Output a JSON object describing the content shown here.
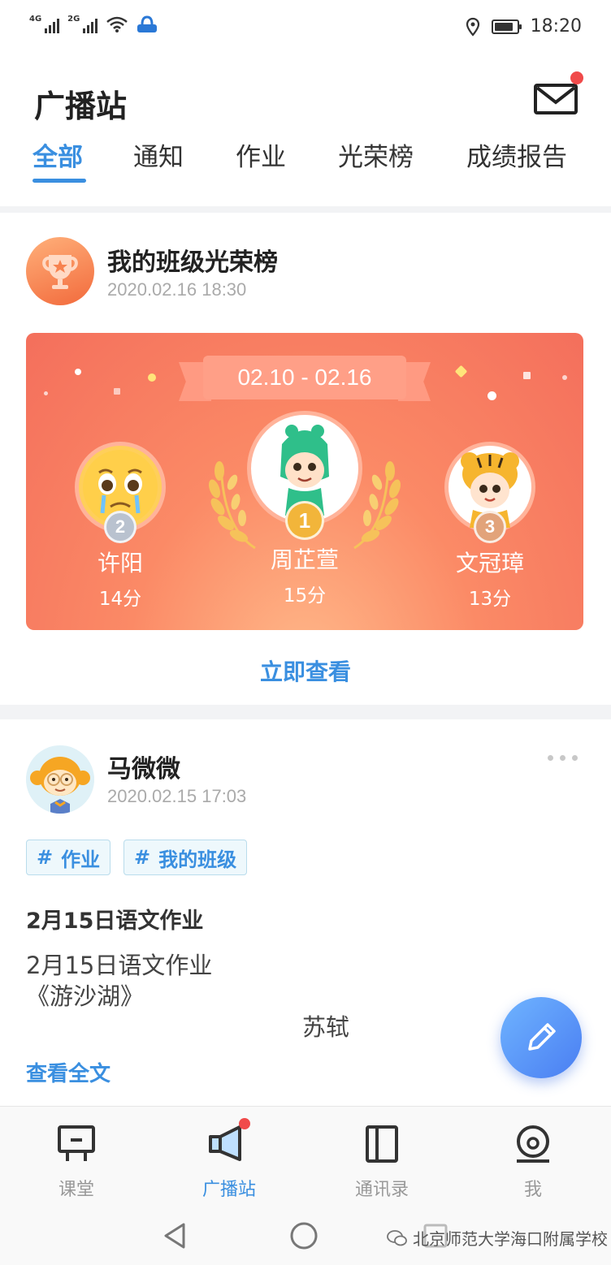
{
  "status_bar": {
    "network1": "4G",
    "network2": "2G",
    "time": "18:20",
    "battery_level": 0.85
  },
  "header": {
    "title": "广播站",
    "mail_icon": "mail-icon",
    "has_unread": true
  },
  "tabs": [
    {
      "label": "全部",
      "active": true
    },
    {
      "label": "通知",
      "active": false
    },
    {
      "label": "作业",
      "active": false
    },
    {
      "label": "光荣榜",
      "active": false
    },
    {
      "label": "成绩报告",
      "active": false
    }
  ],
  "honor_post": {
    "title": "我的班级光荣榜",
    "time": "2020.02.16 18:30",
    "date_range": "02.10 - 02.16",
    "winners": [
      {
        "rank": "2",
        "name": "许阳",
        "score": "14分"
      },
      {
        "rank": "1",
        "name": "周芷萱",
        "score": "15分"
      },
      {
        "rank": "3",
        "name": "文冠璋",
        "score": "13分"
      }
    ],
    "view_label": "立即查看"
  },
  "homework_post": {
    "author": "马微微",
    "time": "2020.02.15 17:03",
    "tags": [
      {
        "hash": "#",
        "label": "作业"
      },
      {
        "hash": "#",
        "label": "我的班级"
      }
    ],
    "title": "2月15日语文作业",
    "lines": [
      "2月15日语文作业",
      "《游沙湖》",
      "苏轼"
    ],
    "read_more": "查看全文"
  },
  "bottom_nav": [
    {
      "label": "课堂",
      "icon": "classroom-icon",
      "active": false
    },
    {
      "label": "广播站",
      "icon": "megaphone-icon",
      "active": true
    },
    {
      "label": "通讯录",
      "icon": "contacts-icon",
      "active": false
    },
    {
      "label": "我",
      "icon": "profile-icon",
      "active": false
    }
  ],
  "watermark": "北京师范大学海口附属学校",
  "colors": {
    "accent": "#3a8fe0",
    "badge_red": "#f04a4a",
    "banner": "#f46f5c",
    "gold": "#f2b53a",
    "silver": "#b9c2cf",
    "bronze": "#e2a37a"
  }
}
